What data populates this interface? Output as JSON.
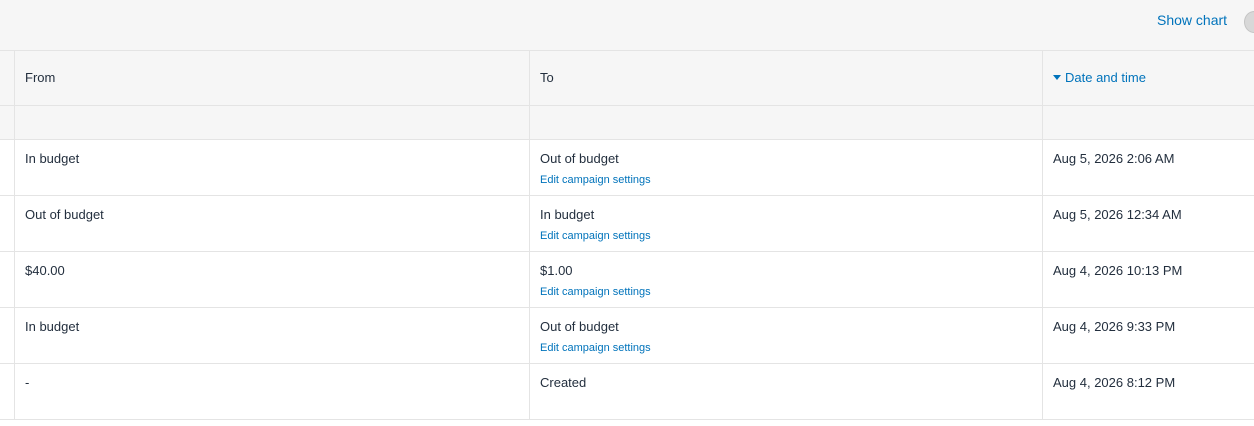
{
  "toolbar": {
    "show_chart_label": "Show chart"
  },
  "table": {
    "headers": {
      "from": "From",
      "to": "To",
      "date": "Date and time"
    },
    "sort": {
      "column": "Date and time",
      "direction": "descending"
    },
    "rows": [
      {
        "from": "In budget",
        "to": "Out of budget",
        "link": "Edit campaign settings",
        "date": "Aug 5, 2026 2:06 AM"
      },
      {
        "from": "Out of budget",
        "to": "In budget",
        "link": "Edit campaign settings",
        "date": "Aug 5, 2026 12:34 AM"
      },
      {
        "from": "$40.00",
        "to": "$1.00",
        "link": "Edit campaign settings",
        "date": "Aug 4, 2026 10:13 PM"
      },
      {
        "from": "In budget",
        "to": "Out of budget",
        "link": "Edit campaign settings",
        "date": "Aug 4, 2026 9:33 PM"
      },
      {
        "from": "-",
        "to": "Created",
        "link": "",
        "date": "Aug 4, 2026 8:12 PM"
      }
    ]
  },
  "colors": {
    "link": "#0073bb",
    "text": "#232f3e",
    "header_bg": "#f6f6f6",
    "border": "#e4e4e4"
  }
}
